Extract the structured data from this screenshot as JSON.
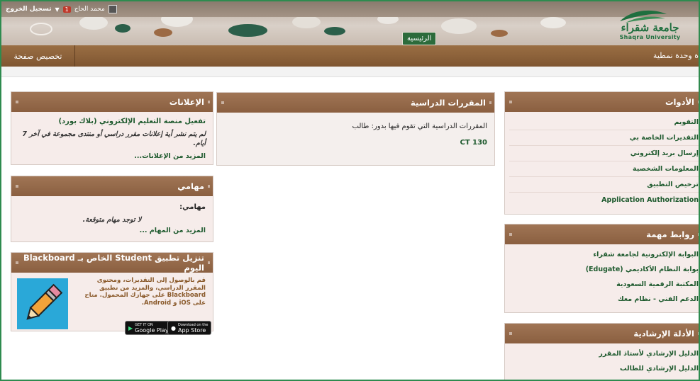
{
  "header": {
    "user_name": "محمد الحاج",
    "notification_count": "1",
    "logout_label": "تسجيل الخروج",
    "home_tab": "الرئيسية",
    "logo_ar": "جامعة شقراء",
    "logo_en": "Shaqra University"
  },
  "navbar": {
    "customize_label": "تخصيص صفحة",
    "add_module_label": "ة وحدة نمطية"
  },
  "announcements": {
    "title": "الإعلانات",
    "item_title": "تفعيل منصة التعليم الإلكتروني (بلاك بورد)",
    "empty_text": "لم يتم نشر أية إعلانات مقرر دراسي أو منتدى مجموعة في آخر 7 أيام.",
    "more_link": "المزيد من الإعلانات..."
  },
  "tasks": {
    "title": "مهامي",
    "label": "مهامي:",
    "empty_text": "لا توجد مهام متوقعة.",
    "more_link": "المزيد من المهام ..."
  },
  "blackboard_app": {
    "title": "تنزيل تطبيق Student الخاص بـ Blackboard اليوم",
    "text": "قم بالوصول إلى التقديرات، ومحتوى المقرر الدراسي، والمزيد من تطبيق Blackboard على جهازك المحمول. متاح على iOS و Android.",
    "google_play_small": "GET IT ON",
    "google_play": "Google Play",
    "app_store_small": "Download on the",
    "app_store": "App Store"
  },
  "courses": {
    "title": "المقررات الدراسية",
    "subtitle": "المقررات الدراسية التي تقوم فيها بدور: طالب",
    "items": [
      "CT 130"
    ]
  },
  "tools": {
    "title": "الأدوات",
    "items": [
      "التقويم",
      "التقديرات الخاصة بي",
      "إرسال بريد إلكتروني",
      "المعلومات الشخصية",
      "ترخيص التطبيق",
      "Application Authorization"
    ]
  },
  "links": {
    "title": "روابط مهمة",
    "items": [
      "البوابة الإلكترونية لجامعة شقراء",
      "بوابة النظام الأكاديمي (Edugate)",
      "المكتبة الرقمية السعودية",
      "الدعم الفني - نظام معك"
    ]
  },
  "guides": {
    "title": "الأدلة الإرشادية",
    "items": [
      "الدليل الإرشادي لأستاذ المقرر",
      "الدليل الإرشادي للطالب"
    ]
  },
  "colors": {
    "panel_header": "#8a5f40",
    "link_green": "#1e5a2e",
    "frame_green": "#2e8b4f"
  }
}
